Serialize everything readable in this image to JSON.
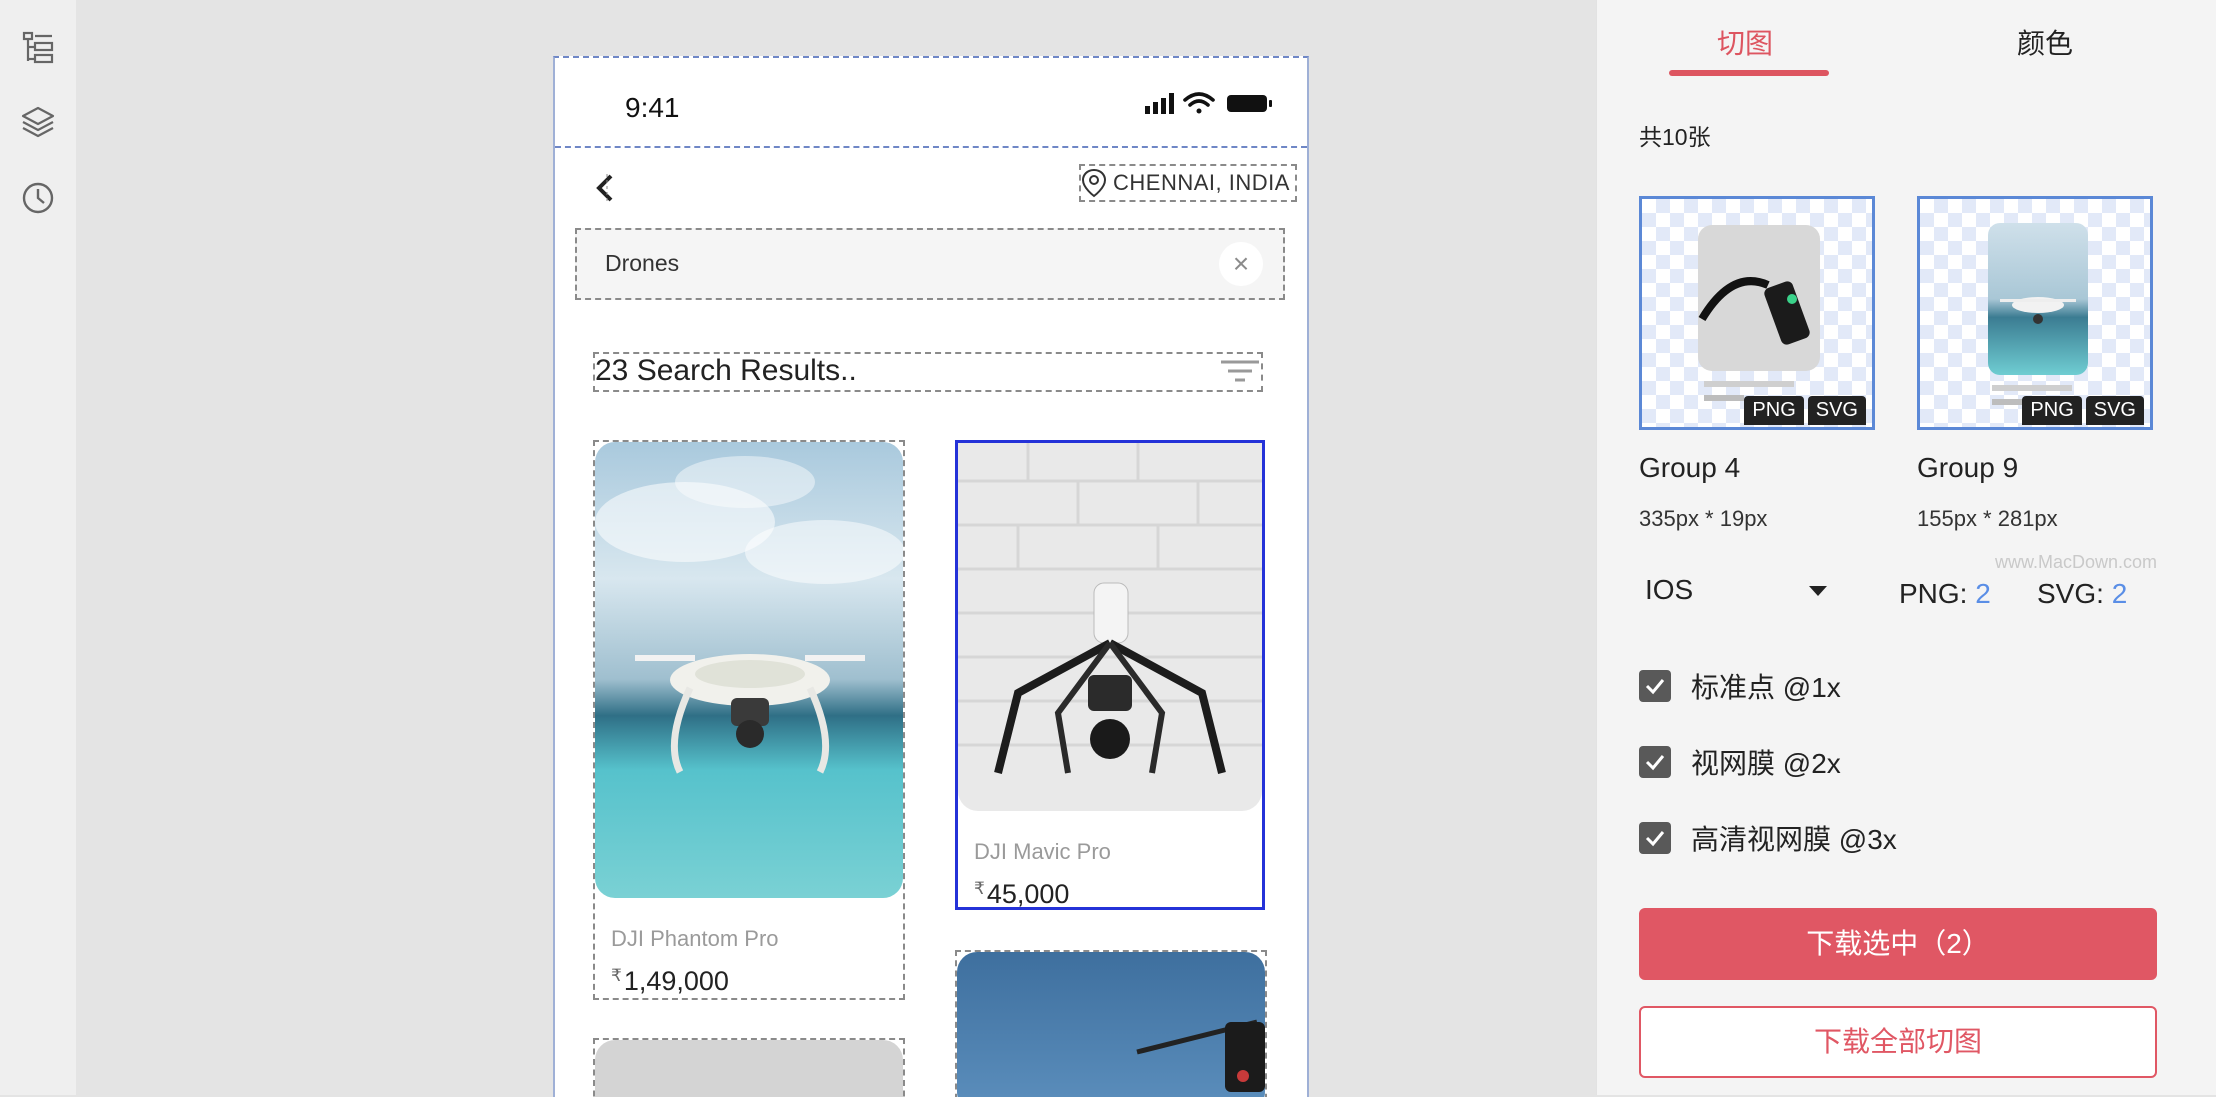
{
  "phone": {
    "time": "9:41",
    "location": "CHENNAI, INDIA",
    "search_value": "Drones",
    "results_text": "23 Search Results..",
    "products": [
      {
        "name": "DJI Phantom Pro",
        "currency": "₹",
        "price": "1,49,000"
      },
      {
        "name": "DJI Mavic Pro",
        "currency": "₹",
        "price": "45,000"
      }
    ]
  },
  "panel": {
    "tabs": [
      "切图",
      "颜色"
    ],
    "active_tab": "切图",
    "count_label": "共10张",
    "slices": [
      {
        "name": "Group 4",
        "size": "335px * 19px",
        "formats": [
          "PNG",
          "SVG"
        ]
      },
      {
        "name": "Group 9",
        "size": "155px * 281px",
        "formats": [
          "PNG",
          "SVG"
        ]
      }
    ],
    "platform": "IOS",
    "png_label": "PNG:",
    "png_count": "2",
    "svg_label": "SVG:",
    "svg_count": "2",
    "watermark": "www.MacDown.com",
    "scales": [
      {
        "label": "标准点 @1x",
        "checked": true
      },
      {
        "label": "视网膜 @2x",
        "checked": true
      },
      {
        "label": "高清视网膜 @3x",
        "checked": true
      }
    ],
    "download_selected_label": "下载选中（2）",
    "download_all_label": "下载全部切图"
  },
  "colors": {
    "accent": "#e05764",
    "selection_blue": "#2432d8",
    "slice_border": "#5b88d6"
  }
}
